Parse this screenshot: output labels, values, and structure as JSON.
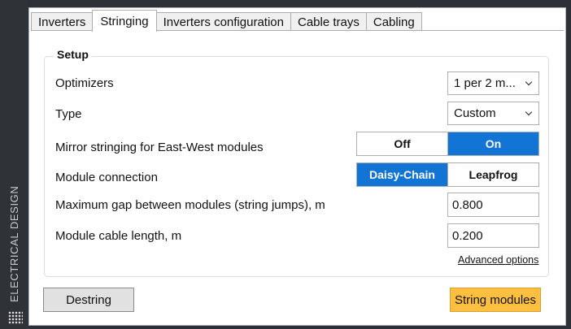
{
  "sidebar": {
    "label": "ELECTRICAL DESIGN",
    "icon": "dots-grid-icon"
  },
  "tabs": [
    {
      "label": "Inverters",
      "active": false
    },
    {
      "label": "Stringing",
      "active": true
    },
    {
      "label": "Inverters configuration",
      "active": false
    },
    {
      "label": "Cable trays",
      "active": false
    },
    {
      "label": "Cabling",
      "active": false
    }
  ],
  "setup": {
    "title": "Setup",
    "optimizers": {
      "label": "Optimizers",
      "value": "1 per 2 m..."
    },
    "type": {
      "label": "Type",
      "value": "Custom"
    },
    "mirror": {
      "label": "Mirror stringing for East-West modules",
      "options": [
        "Off",
        "On"
      ],
      "selected": "On"
    },
    "module_connection": {
      "label": "Module connection",
      "options": [
        "Daisy-Chain",
        "Leapfrog"
      ],
      "selected": "Daisy-Chain"
    },
    "max_gap": {
      "label": "Maximum gap between modules (string jumps), m",
      "value": "0.800"
    },
    "cable_length": {
      "label": "Module cable length, m",
      "value": "0.200"
    },
    "advanced_link": "Advanced options"
  },
  "buttons": {
    "destring": "Destring",
    "string_modules": "String modules"
  },
  "colors": {
    "accent": "#1274d4",
    "primary_button": "#fdbf3f",
    "sidebar": "#2f3237"
  }
}
